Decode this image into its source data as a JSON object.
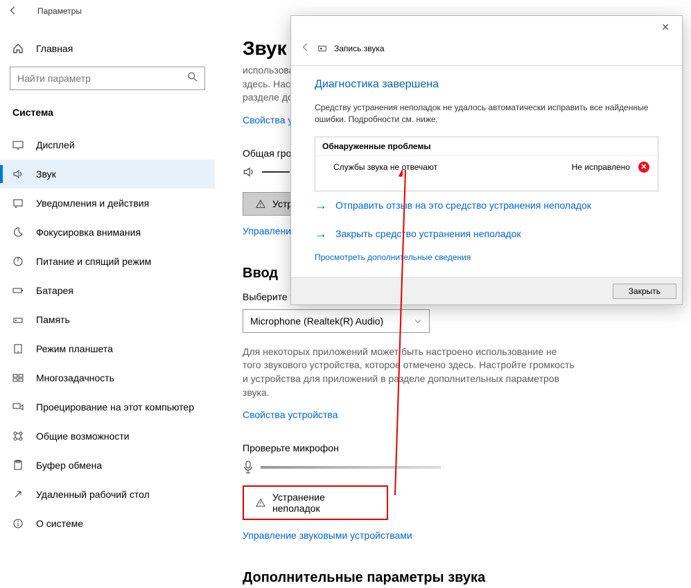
{
  "titlebar": {
    "title": "Параметры"
  },
  "sidebar": {
    "home": "Главная",
    "search_placeholder": "Найти параметр",
    "section": "Система",
    "items": [
      {
        "label": "Дисплей"
      },
      {
        "label": "Звук"
      },
      {
        "label": "Уведомления и действия"
      },
      {
        "label": "Фокусировка внимания"
      },
      {
        "label": "Питание и спящий режим"
      },
      {
        "label": "Батарея"
      },
      {
        "label": "Память"
      },
      {
        "label": "Режим планшета"
      },
      {
        "label": "Многозадачность"
      },
      {
        "label": "Проецирование на этот компьютер"
      },
      {
        "label": "Общие возможности"
      },
      {
        "label": "Буфер обмена"
      },
      {
        "label": "Удаленный рабочий стол"
      },
      {
        "label": "О системе"
      }
    ]
  },
  "main": {
    "title": "Звук",
    "desc_truncated": "использова\nздесь. Наст\nразделе до",
    "device_props": "Свойства у",
    "volume_label": "Общая гро",
    "troubleshoot1": "Устр",
    "manage_link": "Управлени",
    "input_head": "Ввод",
    "input_label": "Выберите устройство ввода",
    "input_device": "Microphone (Realtek(R) Audio)",
    "input_desc": "Для некоторых приложений может быть настроено использование не того звукового устройства, которое отмечено здесь. Настройте громкость и устройства для приложений в разделе дополнительных параметров звука.",
    "device_props2": "Свойства устройства",
    "mic_check": "Проверьте микрофон",
    "troubleshoot2": "Устранение неполадок",
    "manage_link2": "Управление звуковыми устройствами",
    "extra_head": "Дополнительные параметры звука"
  },
  "dialog": {
    "app_name": "Запись звука",
    "heading": "Диагностика завершена",
    "body": "Средству устранения неполадок не удалось автоматически исправить все найденные ошибки. Подробности см. ниже.",
    "problems_title": "Обнаруженные проблемы",
    "problem": "Службы звука не отвечают",
    "problem_status": "Не исправлено",
    "feedback_link": "Отправить отзыв на это средство устранения неполадок",
    "close_ts_link": "Закрыть средство устранения неполадок",
    "details_link": "Просмотреть дополнительные сведения",
    "close_btn": "Закрыть"
  }
}
